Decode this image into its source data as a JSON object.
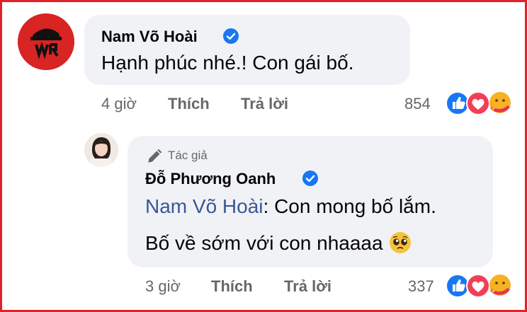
{
  "top_comment": {
    "author": "Nam Võ Hoài",
    "text": "Hạnh phúc nhé.! Con gái bố.",
    "time": "4 giờ",
    "like_label": "Thích",
    "reply_label": "Trả lời",
    "reaction_count": "854"
  },
  "reply": {
    "badge": "Tác giả",
    "author": "Đỗ Phương Oanh",
    "mention": "Nam Võ Hoài",
    "text_line1": ": Con mong bố lắm.",
    "text_line2": "Bố về sớm với con nhaaaa",
    "time": "3 giờ",
    "like_label": "Thích",
    "reply_label": "Trả lời",
    "reaction_count": "337"
  },
  "colors": {
    "frame": "#e0232a",
    "bubble": "#f0f2f5",
    "meta": "#65676b",
    "mention": "#385898",
    "verified": "#1877f2",
    "like": "#1877f2",
    "love": "#f33e58",
    "care": "#f7b125"
  },
  "icons": [
    "verified-badge-icon",
    "pen-icon",
    "pleading-face-emoji",
    "like-reaction-icon",
    "love-reaction-icon",
    "care-reaction-icon"
  ]
}
